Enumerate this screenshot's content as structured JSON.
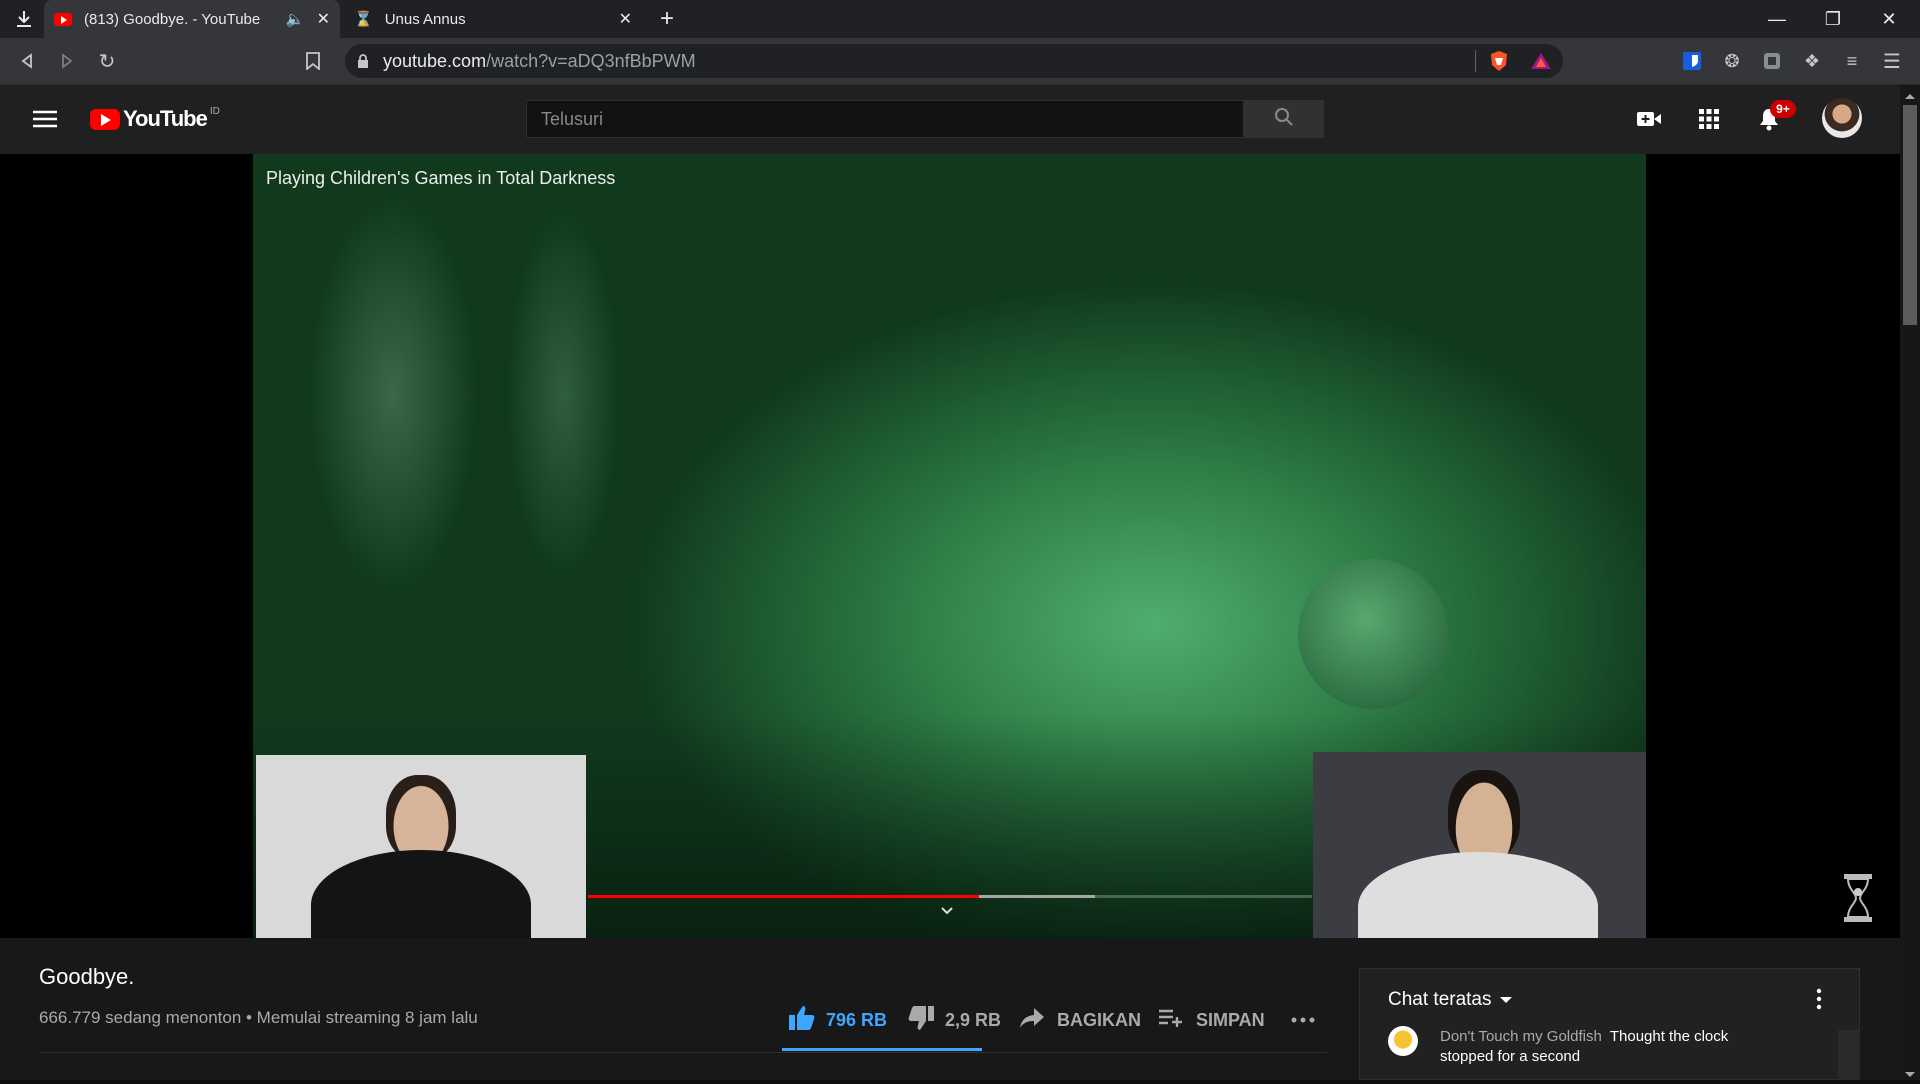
{
  "browser": {
    "tabs": [
      {
        "title": "(813) Goodbye. - YouTube",
        "active": true
      },
      {
        "title": "Unus Annus",
        "active": false
      }
    ],
    "url_host": "youtube.com",
    "url_path": "/watch?v=aDQ3nfBbPWM"
  },
  "youtube": {
    "logo_text": "YouTube",
    "logo_region": "ID",
    "search_placeholder": "Telusuri",
    "notification_count": "9+"
  },
  "video": {
    "overlay_title": "Playing Children's Games in Total Darkness",
    "progress_played": 0.54,
    "progress_buffered": 0.7,
    "title": "Goodbye.",
    "meta": "666.779 sedang menonton • Memulai streaming 8 jam lalu",
    "likes": "796 RB",
    "dislikes": "2,9 RB",
    "share_label": "BAGIKAN",
    "save_label": "SIMPAN"
  },
  "chat": {
    "header": "Chat teratas",
    "message_author": "Don't Touch my Goldfish",
    "message_text_line1": "Thought the clock",
    "message_text_line2": "stopped for a second"
  },
  "colors": {
    "accent_blue": "#3ea6ff",
    "progress_red": "#ff0000",
    "notif_red": "#cc0000"
  }
}
